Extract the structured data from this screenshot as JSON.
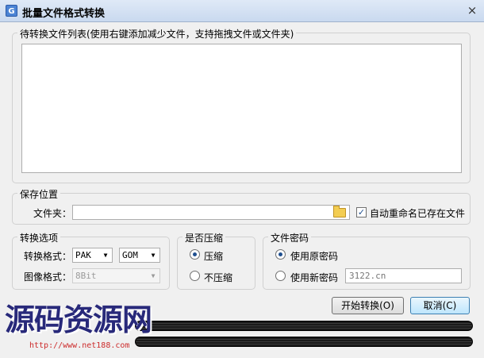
{
  "window": {
    "title": "批量文件格式转换",
    "close_label": "×"
  },
  "file_list": {
    "legend": "待转换文件列表(使用右键添加减少文件，支持拖拽文件或文件夹)"
  },
  "save": {
    "legend": "保存位置",
    "folder_label": "文件夹：",
    "folder_value": "",
    "auto_rename_label": "自动重命名已存在文件",
    "auto_rename_checked": true
  },
  "convert": {
    "legend": "转换选项",
    "format_label": "转换格式：",
    "format_value_1": "PAK",
    "format_value_2": "GOM",
    "image_label": "图像格式：",
    "image_value": "8Bit"
  },
  "compress": {
    "legend": "是否压缩",
    "yes_label": "压缩",
    "no_label": "不压缩",
    "selected": "yes"
  },
  "password": {
    "legend": "文件密码",
    "original_label": "使用原密码",
    "new_label": "使用新密码",
    "selected": "original",
    "new_value": "3122.cn"
  },
  "buttons": {
    "start_label": "开始转换(O)",
    "cancel_label": "取消(C)"
  },
  "watermark": {
    "text": "源码资源网",
    "url": "http://www.net188.com"
  }
}
